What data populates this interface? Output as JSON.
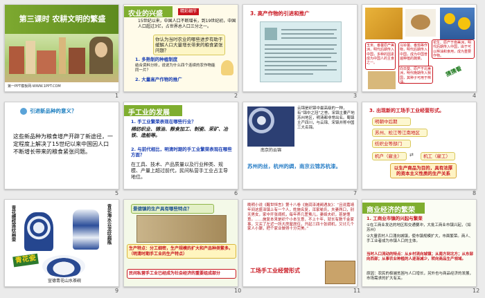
{
  "slides": [
    {
      "num": "1",
      "title": "第三课时 农耕文明的繁盛",
      "footer": "第一PPT模板网-WWW.1PPT.COM"
    },
    {
      "num": "2",
      "heading": "农业的兴盛",
      "tag": "精彩细节",
      "para": "15世纪以来，中国人口不断增长，到19世纪初，中国人口超过3亿，占世界总人口三分之一。",
      "question": "你认为当时农业的哪些进步有助于缓解人口大量增长带来的粮食紧张问题？",
      "item1": "1. 多熟制的种植制度",
      "item1_note": "结合资料分析，说说为什么四个连续的农作物能同一片？",
      "item2": "2. 大量高产作物的推广"
    },
    {
      "num": "3",
      "heading": "3. 高产作物的引进和推广"
    },
    {
      "num": "4",
      "note1": "玉米、番薯原产美洲，明代后期传入中国，多种的因素成为中国人的主食之一。",
      "note2": "马铃薯、番茄等作物，明代后期传入中国，成为中国普遍种植的蔬菜。",
      "note3": "花生、原产于南美洲，明代后期传入中国，由于可以榨油和食用，成为重要作物。",
      "note4": "向日葵、原产于北美洲，明代晚期传入我国，其种子可用于榨油。",
      "caption": "猜猜看"
    },
    {
      "num": "5",
      "heading": "引进新品种的意义？",
      "body": "这些新品种为粮食增产开辟了新途径，一定程度上解决了15世纪以来中国因人口不断增长带来的粮食紧张问题。"
    },
    {
      "num": "6",
      "heading": "手工业的发展",
      "q1": "1. 手工业繁荣表现在哪些行业？",
      "a1": "棉纺织业、锦油、粮食加工、制瓷、采矿、冶铁、造船等。",
      "q2": "2. 与前代相比，明清时期的手工业繁荣表现在哪些方面？",
      "a2": "在工具、技术、产品质量以及行业种类、规模、产量上超过前代，民间私营手工业占主导地位。"
    },
    {
      "num": "7",
      "text": "云锦是织锦中最高级的一种，有“锦中之冠”之誉。宋锦主要产地苏州地区，明清都非常出名。蜀锦主产四川，与云锦、宋锦并称中国三大名锦。",
      "label": "南京的云锦",
      "caption": "苏州的丝，杭州的绸，南京云锦苏杭漆。"
    },
    {
      "num": "8",
      "heading": "3. 出现新的工场手工业经营形式。",
      "b1": "明朝中后期",
      "b2": "苏州、松江等江南地区",
      "b3": "纺织业等部门",
      "b4": "机户（雇主）",
      "b5": "机工（雇工）",
      "summary": "以生产商品为目的，具有浓厚的资本主义性质的生产关系"
    },
    {
      "num": "9",
      "vert1": "青花缠枝莲纹扁壶",
      "vert2": "青花海水云龙纹扁瓶",
      "label": "青花瓷",
      "caption": "宣德青花山水茶碗"
    },
    {
      "num": "10",
      "question": "景德镇的生产具有哪些特点？",
      "p1": "生产特点：分工细密，生产规模的扩大和产品种类繁多。（明清时期手工业的生产特点）",
      "p2": "民间私营手工业已经成为社会经济的重要组成部分"
    },
    {
      "num": "11",
      "para": "晚明小说《醒世恒言》第十八卷《施润泽滩阙遇友》：“且说嘉靖年间这盛泽镇上有一个人，姓施名复，浑家喻氏，夫妻两口，别无男女，家中开张绸机，每年养几筐蚕儿，妻络夫织，甚是惬意。……施复本来是织个小本生意，不上十年，就长有数千金家事，又买了左近一所大房屋居住，开起三四十张绸机，又讨几个家人小厮，把个家业做得十分完美。”",
      "caption": "工场手工业经营形式"
    },
    {
      "num": "12",
      "heading": "商业经济的繁荣",
      "sub": "1. 工商业市镇的兴起与繁荣",
      "p1": "①在工商业发达的地区和交通要冲，大批工商业市镇兴起，（如苏州）",
      "p2": "②大量农村人口涌向城镇，使市镇规模扩大，市面繁荣。商人、手工业者成为市镇人口的主体。",
      "p3": "当时人口流动的特点：从乡村流向城镇；从南方到北方；从东部向西部；从事农业种植的人逐渐减少，转向商品生产领域。",
      "p4": "原因：农民的极端贫困与人口增长，另外也与商品经济的发展，市场需求的扩大有关。"
    }
  ]
}
